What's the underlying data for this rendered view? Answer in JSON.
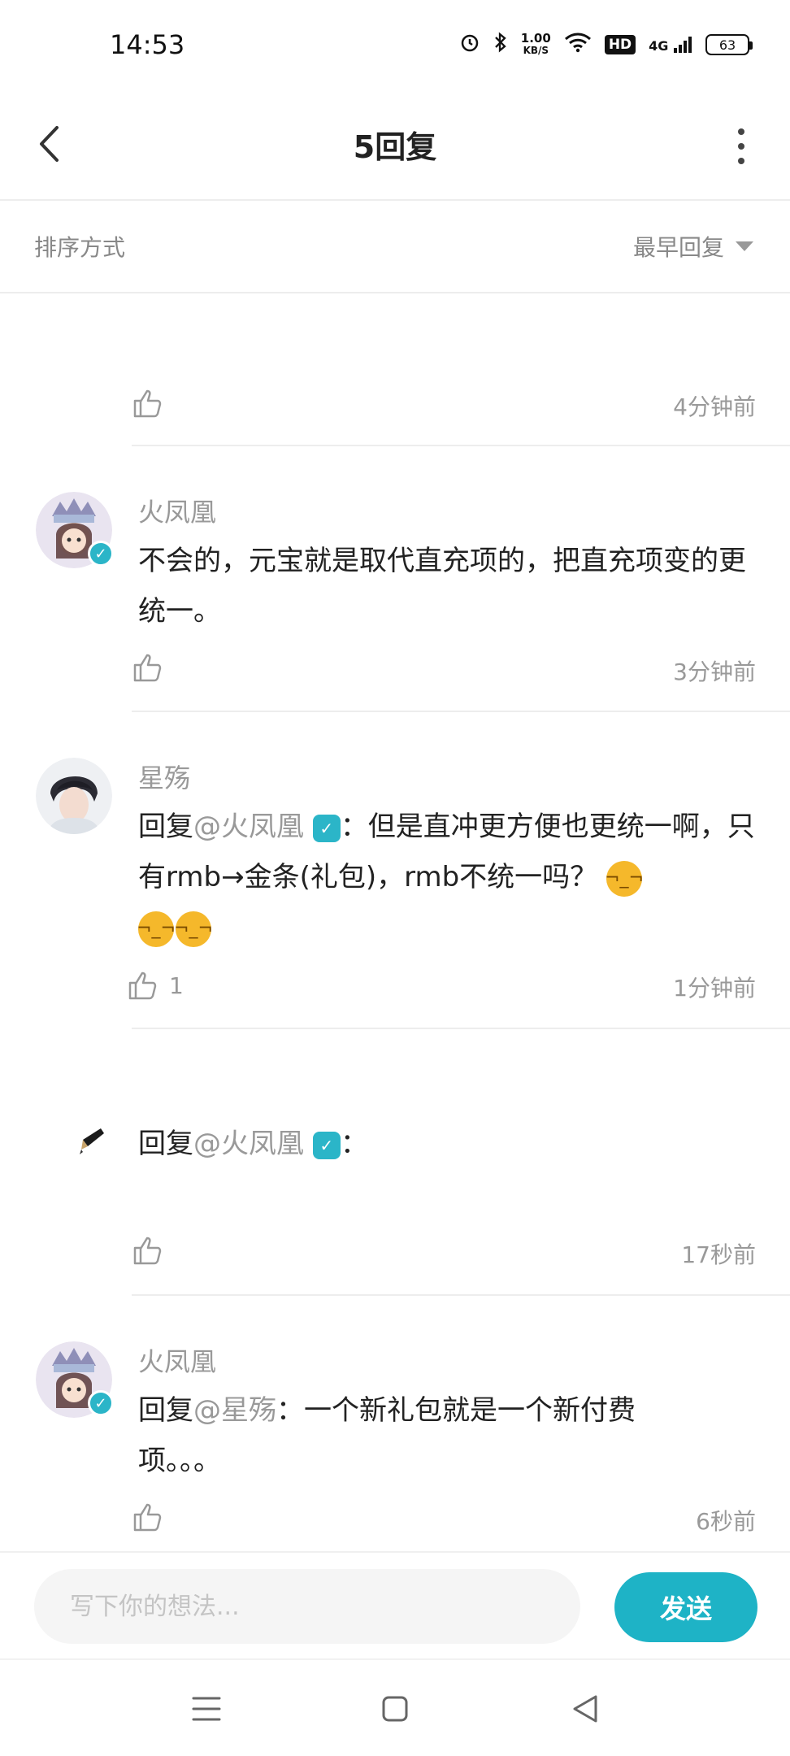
{
  "status_bar": {
    "time": "14:53",
    "net_speed_value": "1.00",
    "net_speed_unit": "KB/S",
    "hd_label": "HD",
    "signal_label": "4G",
    "battery": "63"
  },
  "header": {
    "title": "5回复"
  },
  "sort": {
    "label": "排序方式",
    "selected": "最早回复"
  },
  "replies": [
    {
      "time": "4分钟前",
      "likes": ""
    },
    {
      "username": "火凤凰",
      "verified": true,
      "content": "不会的，元宝就是取代直充项的，把直充项变的更统一。",
      "time": "3分钟前",
      "likes": ""
    },
    {
      "username": "星殇",
      "verified": false,
      "reply_prefix": "回复",
      "mention": "@火凤凰",
      "content": "：但是直冲更方便也更统一啊，只有rmb→金条(礼包)，rmb不统一吗？",
      "time": "1分钟前",
      "likes": "1"
    },
    {
      "username": "",
      "verified": false,
      "reply_prefix": "回复",
      "mention": "@火凤凰",
      "content": "：",
      "time": "17秒前",
      "likes": ""
    },
    {
      "username": "火凤凰",
      "verified": true,
      "reply_prefix": "回复",
      "mention": "@星殇",
      "content": "：一个新礼包就是一个新付费项。。。",
      "time": "6秒前",
      "likes": ""
    }
  ],
  "composer": {
    "placeholder": "写下你的想法...",
    "send_label": "发送"
  },
  "colors": {
    "accent": "#1eb3c6",
    "muted_text": "#999999",
    "divider": "#ededed"
  },
  "icons": [
    "back-arrow-icon",
    "more-vertical-icon",
    "dropdown-triangle-icon",
    "thumbs-up-icon",
    "verified-badge-icon",
    "unamused-face-emoji",
    "menu-icon",
    "home-square-icon",
    "back-triangle-icon"
  ]
}
